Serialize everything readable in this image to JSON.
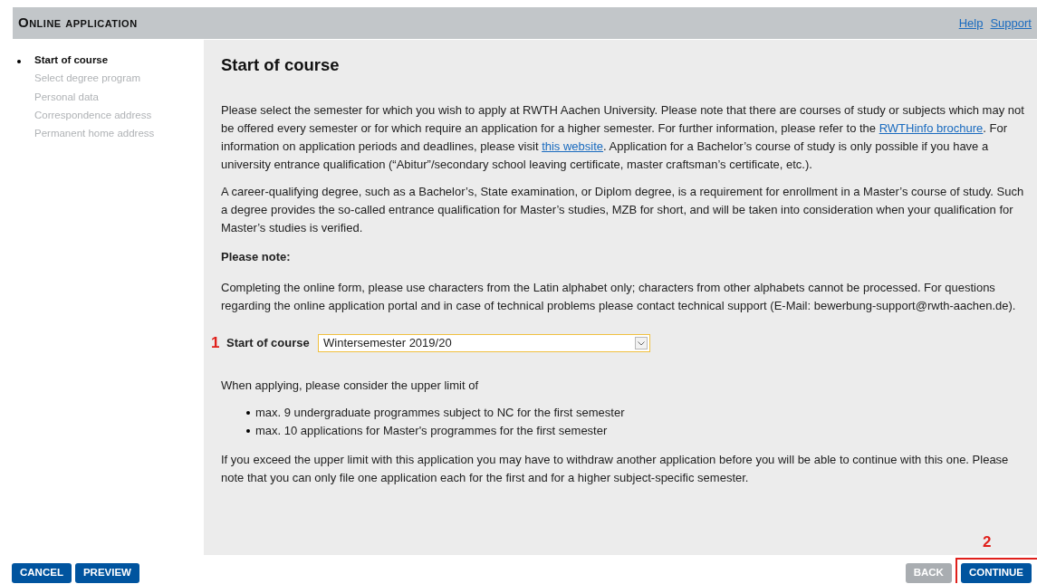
{
  "header": {
    "title": "Online application",
    "links": [
      "Help",
      "Support"
    ]
  },
  "steps": [
    {
      "label": "Start of course",
      "selected": true
    },
    {
      "label": "Select degree program",
      "selected": false
    },
    {
      "label": "Personal data",
      "selected": false
    },
    {
      "label": "Correspondence address",
      "selected": false
    },
    {
      "label": "Permanent home address",
      "selected": false
    }
  ],
  "main": {
    "heading": "Start of course",
    "paragraphs": [
      [
        {
          "kind": "text",
          "text": "Please select the semester for which you wish to apply at RWTH Aachen University. Please note that there are courses of study or subjects which may not be offered every semester or for which require an application for a higher semester. For further information, please refer to the "
        },
        {
          "kind": "link",
          "text": "RWTHinfo brochure"
        },
        {
          "kind": "text",
          "text": ". For information on application periods and deadlines, please visit "
        },
        {
          "kind": "link",
          "text": "this website"
        },
        {
          "kind": "text",
          "text": ". Application for a Bachelor’s course of study is only possible if you have a university entrance qualification (“Abitur”/secondary school leaving certificate, master craftsman’s certificate, etc.)."
        }
      ],
      [
        {
          "kind": "text",
          "text": "A career-qualifying degree, such as a Bachelor’s, State examination, or Diplom degree, is a requirement for enrollment in a Master’s course of study. Such a degree provides the so-called entrance qualification for Master’s studies, MZB for short, and will be taken into consideration when your qualification for Master’s studies is verified."
        }
      ]
    ],
    "note_heading": "Please note:",
    "note": "Completing the online form, please use characters from the Latin alphabet only; characters from other alphabets cannot be processed. For questions regarding the online application portal and in case of technical problems please contact technical support (E-Mail: bewerbung-support@rwth-aachen.de).",
    "field": {
      "marker": "1",
      "label": "Start of course",
      "value": "Wintersemester 2019/20"
    },
    "limit_intro": "When applying, please consider the upper limit of",
    "limits": [
      "max. 9 undergraduate programmes subject to NC for the first semester",
      "max. 10 applications for Master's programmes for the first semester"
    ],
    "closing": "If you exceed the upper limit with this application you may have to withdraw another application before you will be able to continue with this one. Please note that you can only file one application each for the first and for a higher subject-specific semester."
  },
  "buttons_left": [
    {
      "label": "CANCEL",
      "disabled": false
    },
    {
      "label": "PREVIEW",
      "disabled": false
    }
  ],
  "buttons_right": [
    {
      "label": "BACK",
      "disabled": true
    },
    {
      "label": "CONTINUE",
      "disabled": false,
      "marker": "2",
      "highlighted": true
    }
  ]
}
